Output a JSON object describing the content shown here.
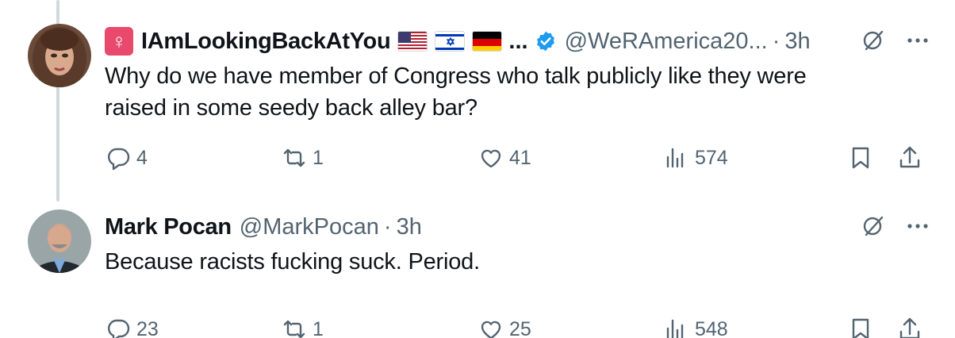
{
  "tweets": [
    {
      "name": "IAmLookingBackAtYou",
      "name_suffix": "...",
      "handle": "@WeRAmerica20...",
      "time": "3h",
      "text": "Why do we have member of Congress who talk publicly like they were raised in some seedy back alley bar?",
      "replies": "4",
      "retweets": "1",
      "likes": "41",
      "views": "574",
      "icons": [
        "female-sign-icon",
        "us-flag-icon",
        "israel-flag-icon",
        "germany-flag-icon",
        "verified-badge-icon",
        "grok-icon",
        "more-icon"
      ]
    },
    {
      "name": "Mark Pocan",
      "handle": "@MarkPocan",
      "time": "3h",
      "text": "Because racists fucking suck. Period.",
      "replies": "23",
      "retweets": "1",
      "likes": "25",
      "views": "548",
      "icons": [
        "grok-icon",
        "more-icon"
      ]
    }
  ],
  "separator": "·",
  "colors": {
    "text": "#0f1419",
    "secondary": "#536471",
    "thread_line": "#cfd9de",
    "verified": "#1d9bf0",
    "gender_badge": "#e8496d"
  }
}
